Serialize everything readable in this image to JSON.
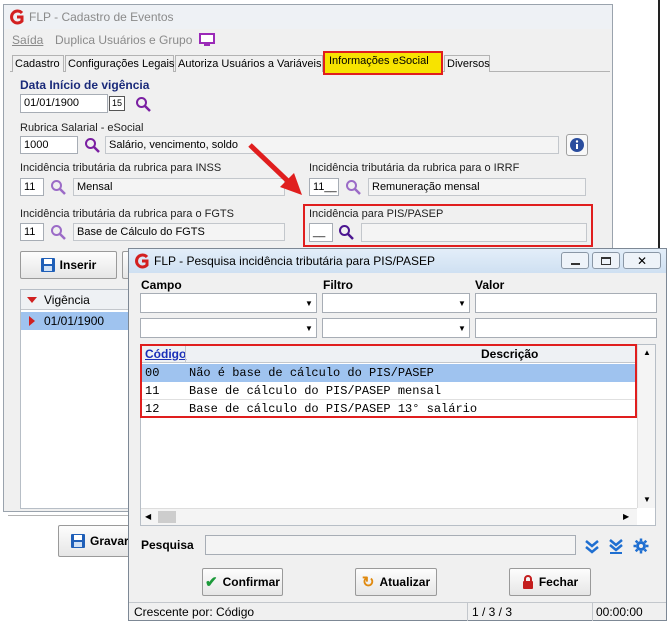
{
  "main": {
    "title": "FLP - Cadastro de Eventos",
    "menu": {
      "saida": "Saída",
      "duplica": "Duplica Usuários e Grupo"
    },
    "tabs": [
      "Cadastro",
      "Configurações Legais",
      "Autoriza Usuários a Variáveis",
      "Informações eSocial",
      "Diversos"
    ],
    "vigencia_label": "Data Início de vigência",
    "vigencia_value": "01/01/1900",
    "calendar_btn": "15",
    "rubrica_label": "Rubrica Salarial - eSocial",
    "rubrica_code": "1000",
    "rubrica_desc": "Salário, vencimento, soldo",
    "inss_label": "Incidência tributária da rubrica para INSS",
    "inss_code": "11",
    "inss_desc": "Mensal",
    "irrf_label": "Incidência tributária da rubrica para o IRRF",
    "irrf_code": "11__",
    "irrf_desc": "Remuneração mensal",
    "fgts_label": "Incidência tributária da rubrica para o FGTS",
    "fgts_code": "11",
    "fgts_desc": "Base de Cálculo do FGTS",
    "pis_label": "Incidência para PIS/PASEP",
    "pis_code": "__",
    "pis_desc": "",
    "inserir": "Inserir",
    "vigencia_col": "Vigência",
    "vigencia_row": "01/01/1900",
    "gravar": "Gravar"
  },
  "dialog": {
    "title": "FLP - Pesquisa incidência tributária para PIS/PASEP",
    "campo_label": "Campo",
    "filtro_label": "Filtro",
    "valor_label": "Valor",
    "columns": {
      "codigo": "Código",
      "descricao": "Descrição"
    },
    "rows": [
      {
        "codigo": "00",
        "descricao": "Não é base de cálculo do PIS/PASEP"
      },
      {
        "codigo": "11",
        "descricao": "Base de cálculo do PIS/PASEP mensal"
      },
      {
        "codigo": "12",
        "descricao": "Base de cálculo do PIS/PASEP 13° salário"
      }
    ],
    "pesquisa_label": "Pesquisa",
    "confirmar": "Confirmar",
    "atualizar": "Atualizar",
    "fechar": "Fechar",
    "status_sort": "Crescente por: Código",
    "status_count": "1 / 3 / 3",
    "status_time": "00:00:00"
  },
  "colors": {
    "highlight": "#e01e1e",
    "tab_active": "#f7e300",
    "row_selected": "#9fc3ef",
    "accent_purple": "#7a1fa2"
  }
}
